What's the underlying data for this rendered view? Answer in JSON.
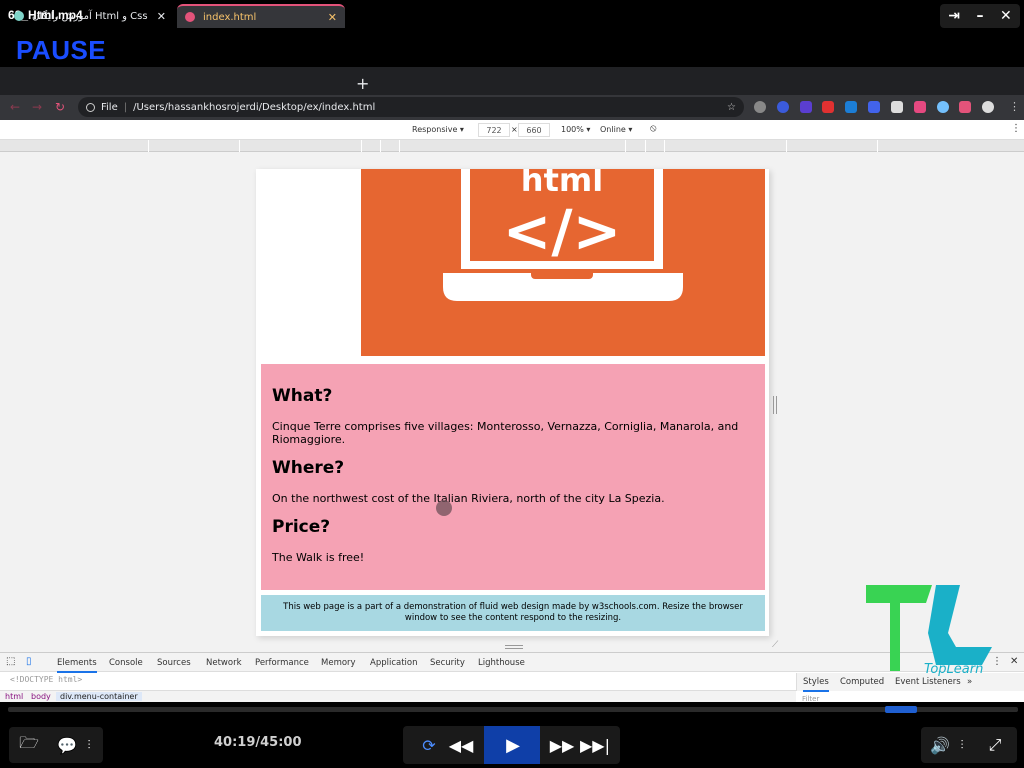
{
  "player": {
    "file_title": "68_Html.mp4",
    "pause_label": "PAUSE",
    "time": "40:19/45:00",
    "progress_fraction": 0.89
  },
  "browser": {
    "tabs": [
      {
        "label": "آموزش رایگان Html و Css",
        "close": "✕"
      },
      {
        "label": "index.html",
        "close": "✕"
      }
    ],
    "new_tab": "+",
    "address_prefix": "File",
    "address": "/Users/hassankhosrojerdi/Desktop/ex/index.html"
  },
  "device_toolbar": {
    "mode": "Responsive ▾",
    "width": "722",
    "times": "×",
    "height": "660",
    "zoom": "100% ▾",
    "network": "Online ▾"
  },
  "page": {
    "hero_text": "html",
    "hero_code": "</>",
    "sections": [
      {
        "heading": "What?",
        "text": "Cinque Terre comprises five villages: Monterosso, Vernazza, Corniglia, Manarola, and Riomaggiore."
      },
      {
        "heading": "Where?",
        "text": "On the northwest cost of the Italian Riviera, north of the city La Spezia."
      },
      {
        "heading": "Price?",
        "text": "The Walk is free!"
      }
    ],
    "footer": "This web page is a part of a demonstration of fluid web design made by w3schools.com. Resize the browser window to see the content respond to the resizing."
  },
  "devtools": {
    "tabs": [
      "Elements",
      "Console",
      "Sources",
      "Network",
      "Performance",
      "Memory",
      "Application",
      "Security",
      "Lighthouse"
    ],
    "doctype": "<!DOCTYPE html>",
    "breadcrumbs": [
      "html",
      "body",
      "div.menu-container"
    ],
    "styles_tabs": [
      "Styles",
      "Computed",
      "Event Listeners",
      "»"
    ],
    "filter_placeholder": "Filter"
  },
  "logo": {
    "text": "TopLearn"
  },
  "colors": {
    "accent": "#1a4dff",
    "hero": "#e66631",
    "content": "#f5a2b4",
    "footer": "#a8d8e2",
    "seek": "#1f5fd1"
  }
}
